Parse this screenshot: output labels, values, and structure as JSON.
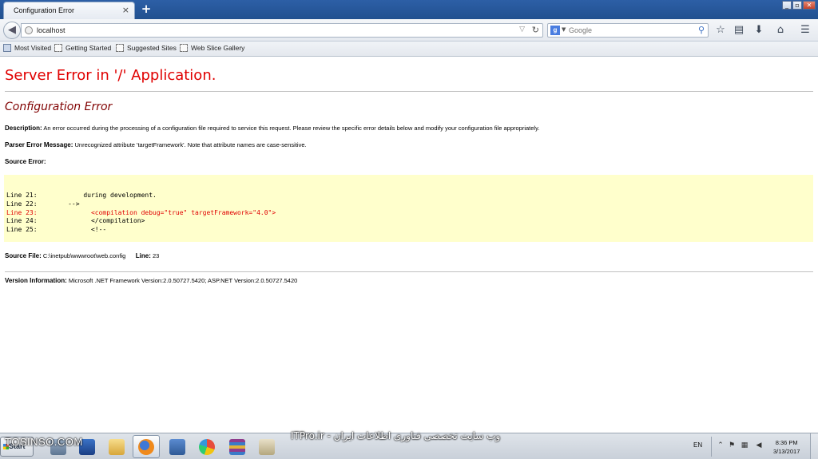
{
  "browser": {
    "tab_title": "Configuration Error",
    "tab_close": "×",
    "new_tab": "+",
    "window_buttons": [
      "_",
      "▫",
      "✕"
    ],
    "url": "localhost",
    "search_placeholder": "Google",
    "search_engine_icon": "google-icon",
    "bookmarks": [
      "Most Visited",
      "Getting Started",
      "Suggested Sites",
      "Web Slice Gallery"
    ],
    "nav_icons": [
      "back-icon",
      "reload-icon",
      "star-icon",
      "clipboard-icon",
      "download-icon",
      "home-icon",
      "menu-icon"
    ]
  },
  "page": {
    "title": "Server Error in '/' Application.",
    "subtitle": "Configuration Error",
    "description_label": "Description:",
    "description_text": "An error occurred during the processing of a configuration file required to service this request. Please review the specific error details below and modify your configuration file appropriately.",
    "parser_label": "Parser Error Message:",
    "parser_text": "Unrecognized attribute 'targetFramework'. Note that attribute names are case-sensitive.",
    "source_error_label": "Source Error:",
    "code_lines": [
      {
        "text": "Line 21:            during development.",
        "error": false
      },
      {
        "text": "Line 22:        -->",
        "error": false
      },
      {
        "text": "Line 23:              <compilation debug=\"true\" targetFramework=\"4.0\">",
        "error": true
      },
      {
        "text": "Line 24:              </compilation>",
        "error": false
      },
      {
        "text": "Line 25:              <!--",
        "error": false
      }
    ],
    "source_file_label": "Source File:",
    "source_file": "C:\\inetpub\\wwwroot\\web.config",
    "line_label": "Line:",
    "line_number": "23",
    "version_label": "Version Information:",
    "version_text": "Microsoft .NET Framework Version:2.0.50727.5420; ASP.NET Version:2.0.50727.5420"
  },
  "taskbar": {
    "start_label": "Start",
    "watermark_left": "TOSINSO.COM",
    "watermark_right": "وب سایت تخصصی فناوری اطلاعات ایران - ITPro.ir",
    "language": "EN",
    "time": "8:36 PM",
    "date": "3/13/2017",
    "apps": [
      "server-manager-icon",
      "powershell-icon",
      "explorer-icon",
      "firefox-icon",
      "network-icon",
      "paint-icon",
      "winrar-icon",
      "tools-icon"
    ]
  },
  "colors": {
    "error_red": "#e00000",
    "subtitle_maroon": "#800000",
    "code_background": "#ffffcc"
  }
}
